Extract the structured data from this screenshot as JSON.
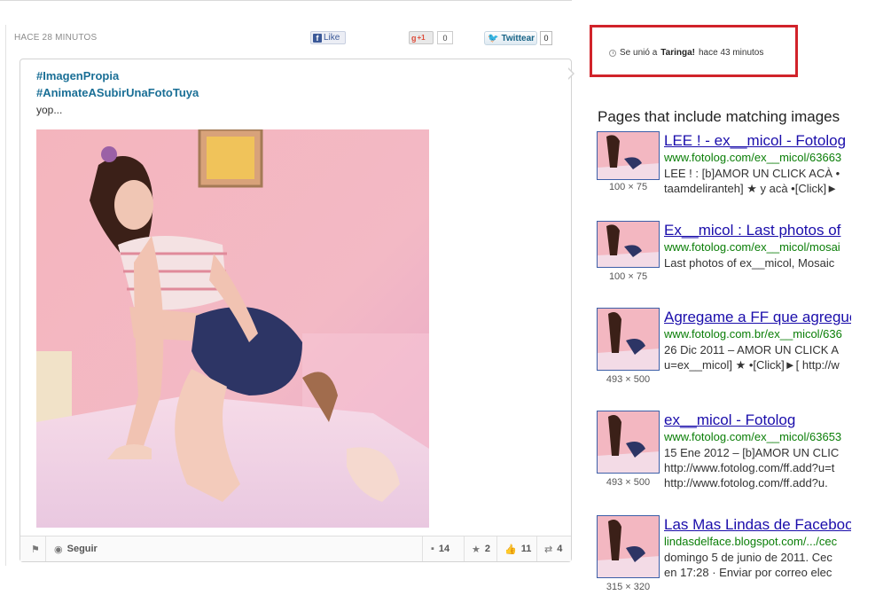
{
  "post": {
    "timestamp": "HACE 28 MINUTOS",
    "share": {
      "facebook_label": "Like",
      "gplus_label": "+1",
      "gplus_count": "0",
      "twitter_label": "Twittear",
      "twitter_count": "0"
    },
    "hashtags": [
      "#ImagenPropia",
      "#AnimateASubirUnaFotoTuya"
    ],
    "text": "yop...",
    "footer": {
      "follow_label": "Seguir",
      "comments": "14",
      "favorites": "2",
      "likes": "11",
      "shares": "4"
    }
  },
  "right_panel": {
    "joined": {
      "prefix": "Se unió a",
      "site": "Taringa!",
      "suffix": "hace 43 minutos"
    },
    "pages_heading": "Pages that include matching images",
    "results": [
      {
        "title": "LEE ! - ex__micol - Fotolog",
        "url": "www.fotolog.com/ex__micol/63663",
        "size": "100 × 75",
        "lines": [
          "LEE ! : [b]AMOR UN CLICK ACÀ •",
          "taamdeliranteh] ★ y acà •[Click]►"
        ]
      },
      {
        "title": "Ex__micol : Last photos of",
        "url": "www.fotolog.com/ex__micol/mosai",
        "size": "100 × 75",
        "lines": [
          "Last photos of ex__micol, Mosaic"
        ]
      },
      {
        "title": "Agregame a FF que agregue",
        "url": "www.fotolog.com.br/ex__micol/636",
        "size": "493 × 500",
        "date": "26 Dic 2011",
        "lines": [
          "26 Dic 2011 – AMOR UN CLICK A",
          "u=ex__micol] ★ •[Click]►[ http://w"
        ]
      },
      {
        "title": "ex__micol - Fotolog",
        "url": "www.fotolog.com/ex__micol/63653",
        "size": "493 × 500",
        "date": "15 Ene 2012",
        "lines": [
          "15 Ene 2012 – [b]AMOR UN CLIC",
          "http://www.fotolog.com/ff.add?u=t",
          "http://www.fotolog.com/ff.add?u."
        ]
      },
      {
        "title": "Las Mas Lindas de Facebook",
        "url": "lindasdelface.blogspot.com/.../cec",
        "size": "315 × 320",
        "lines": [
          "domingo 5 de junio de 2011. Cec",
          "en 17:28 · Enviar por correo elec"
        ]
      }
    ]
  },
  "colors": {
    "link_blue": "#1a0dab",
    "url_green": "#0a7e07",
    "highlight_red": "#d1232a",
    "hashtag_blue": "#1a6f96"
  }
}
